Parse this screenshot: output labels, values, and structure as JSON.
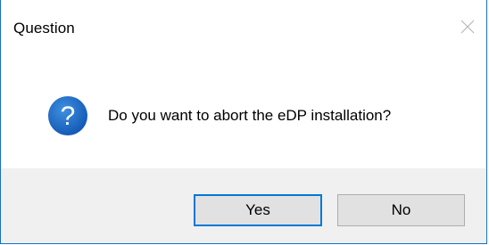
{
  "window": {
    "title": "Question",
    "close_icon": "close-icon"
  },
  "message": {
    "icon": "question-icon",
    "icon_color": "#1565c0",
    "text": "Do you want to abort the eDP installation?"
  },
  "buttons": {
    "yes_label": "Yes",
    "no_label": "No",
    "default": "yes"
  },
  "colors": {
    "accent": "#0078d7",
    "footer_bg": "#f0f0f0",
    "button_bg": "#e1e1e1"
  }
}
